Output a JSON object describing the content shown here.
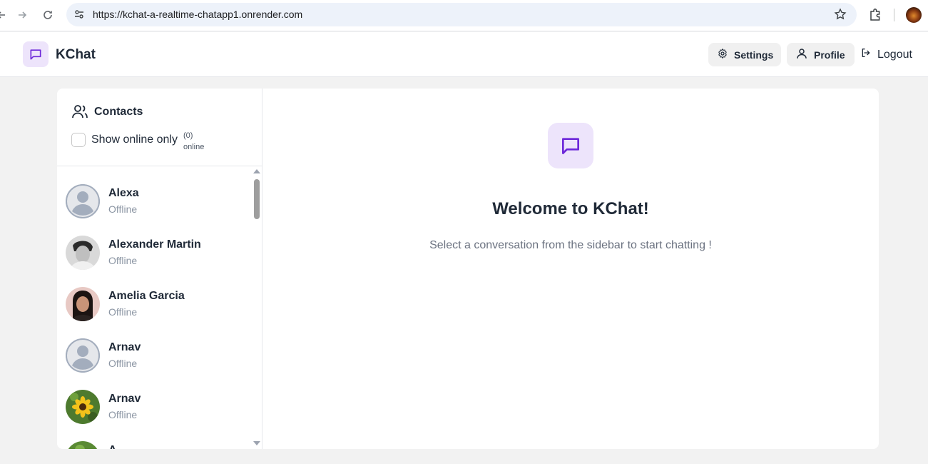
{
  "browser": {
    "url": "https://kchat-a-realtime-chatapp1.onrender.com"
  },
  "header": {
    "brand": "KChat",
    "settings_label": "Settings",
    "profile_label": "Profile",
    "logout_label": "Logout"
  },
  "sidebar": {
    "title": "Contacts",
    "filter_label": "Show online only",
    "online_count": "(0)",
    "online_word": "online",
    "contacts": [
      {
        "name": "Alexa",
        "status": "Offline",
        "avatar": "default"
      },
      {
        "name": "Alexander Martin",
        "status": "Offline",
        "avatar": "photo"
      },
      {
        "name": "Amelia Garcia",
        "status": "Offline",
        "avatar": "photo"
      },
      {
        "name": "Arnav",
        "status": "Offline",
        "avatar": "default"
      },
      {
        "name": "Arnav",
        "status": "Offline",
        "avatar": "photo"
      },
      {
        "name": "A",
        "status": "",
        "avatar": "photo"
      }
    ]
  },
  "main": {
    "welcome_title": "Welcome to KChat!",
    "welcome_subtitle": "Select a conversation from the sidebar to start chatting !"
  },
  "colors": {
    "accent": "#6d28d9",
    "accent_bg": "#ede4fb",
    "page_bg": "#f2f2f2"
  }
}
